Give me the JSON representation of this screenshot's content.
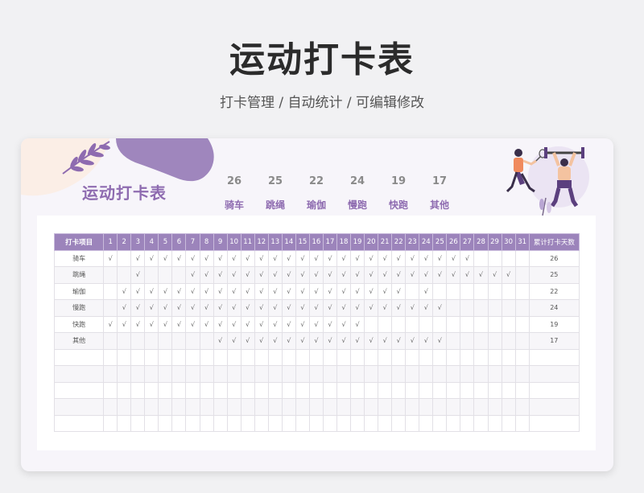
{
  "page": {
    "title": "运动打卡表",
    "subtitle": "打卡管理 / 自动统计 /  可编辑修改"
  },
  "card": {
    "title": "运动打卡表",
    "summary": [
      {
        "count": "26",
        "name": "骑车"
      },
      {
        "count": "25",
        "name": "跳绳"
      },
      {
        "count": "22",
        "name": "瑜伽"
      },
      {
        "count": "24",
        "name": "慢跑"
      },
      {
        "count": "19",
        "name": "快跑"
      },
      {
        "count": "17",
        "name": "其他"
      }
    ]
  },
  "table": {
    "item_header": "打卡项目",
    "days": [
      "1",
      "2",
      "3",
      "4",
      "5",
      "6",
      "7",
      "8",
      "9",
      "10",
      "11",
      "12",
      "13",
      "14",
      "15",
      "16",
      "17",
      "18",
      "19",
      "20",
      "21",
      "22",
      "23",
      "24",
      "25",
      "26",
      "27",
      "28",
      "29",
      "30",
      "31"
    ],
    "total_header": "累计打卡天数",
    "check_mark": "√",
    "rows": [
      {
        "name": "骑车",
        "checks": [
          1,
          3,
          4,
          5,
          6,
          7,
          8,
          9,
          10,
          11,
          12,
          13,
          14,
          15,
          16,
          17,
          18,
          19,
          20,
          21,
          22,
          23,
          24,
          25,
          26,
          27
        ],
        "total": "26"
      },
      {
        "name": "跳绳",
        "checks": [
          3,
          7,
          8,
          9,
          10,
          11,
          12,
          13,
          14,
          15,
          16,
          17,
          18,
          19,
          20,
          21,
          22,
          23,
          24,
          25,
          26,
          27,
          28,
          29,
          30
        ],
        "total": "25"
      },
      {
        "name": "瑜伽",
        "checks": [
          2,
          3,
          4,
          5,
          6,
          7,
          8,
          9,
          10,
          11,
          12,
          13,
          14,
          15,
          16,
          17,
          18,
          19,
          20,
          21,
          22,
          24
        ],
        "total": "22"
      },
      {
        "name": "慢跑",
        "checks": [
          2,
          3,
          4,
          5,
          6,
          7,
          8,
          9,
          10,
          11,
          12,
          13,
          14,
          15,
          16,
          17,
          18,
          19,
          20,
          21,
          22,
          23,
          24,
          25
        ],
        "total": "24"
      },
      {
        "name": "快跑",
        "checks": [
          1,
          2,
          3,
          4,
          5,
          6,
          7,
          8,
          9,
          10,
          11,
          12,
          13,
          14,
          15,
          16,
          17,
          18,
          19
        ],
        "total": "19"
      },
      {
        "name": "其他",
        "checks": [
          9,
          10,
          11,
          12,
          13,
          14,
          15,
          16,
          17,
          18,
          19,
          20,
          21,
          22,
          23,
          24,
          25
        ],
        "total": "17"
      }
    ],
    "blank_rows": 5
  },
  "colors": {
    "accent": "#8e6bb0",
    "header_bg": "#9c84bb",
    "blob": "#9f86bd"
  },
  "icons": [
    "leaf-icon",
    "fitness-illustration"
  ]
}
